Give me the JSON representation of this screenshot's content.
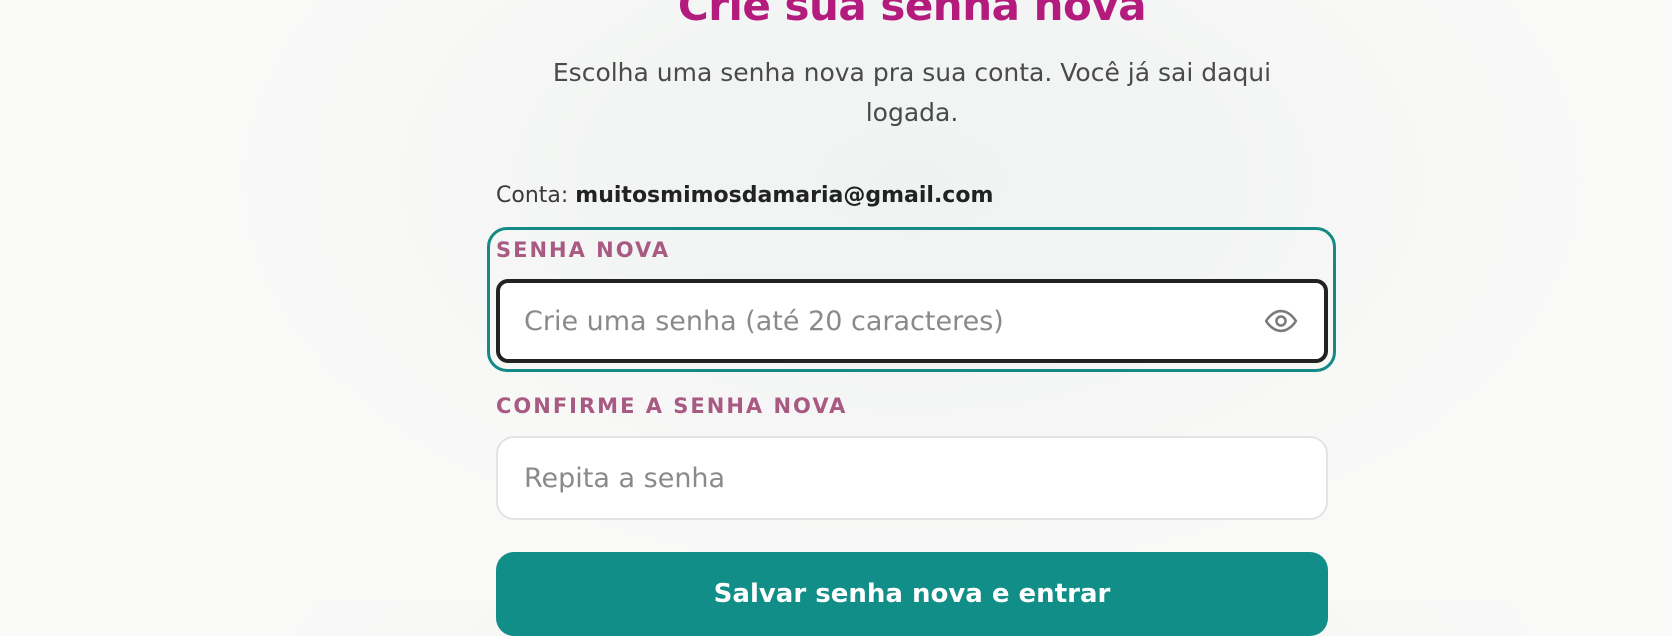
{
  "header": {
    "title": "Crie sua senha nova",
    "subtitle": "Escolha uma senha nova pra sua conta. Você já sai daqui logada."
  },
  "account": {
    "label": "Conta:",
    "email": "muitosmimosdamaria@gmail.com"
  },
  "new_password": {
    "label": "SENHA NOVA",
    "value": "",
    "placeholder": "Crie uma senha (até 20 caracteres)",
    "toggle_icon": "eye-icon",
    "focused": true
  },
  "confirm_password": {
    "label": "CONFIRME A SENHA NOVA",
    "value": "",
    "placeholder": "Repita a senha"
  },
  "submit": {
    "label": "Salvar senha nova e entrar"
  },
  "colors": {
    "title": "#b31b7c",
    "label": "#a85a83",
    "accent": "#118e88",
    "focus_ring": "#138a85"
  }
}
